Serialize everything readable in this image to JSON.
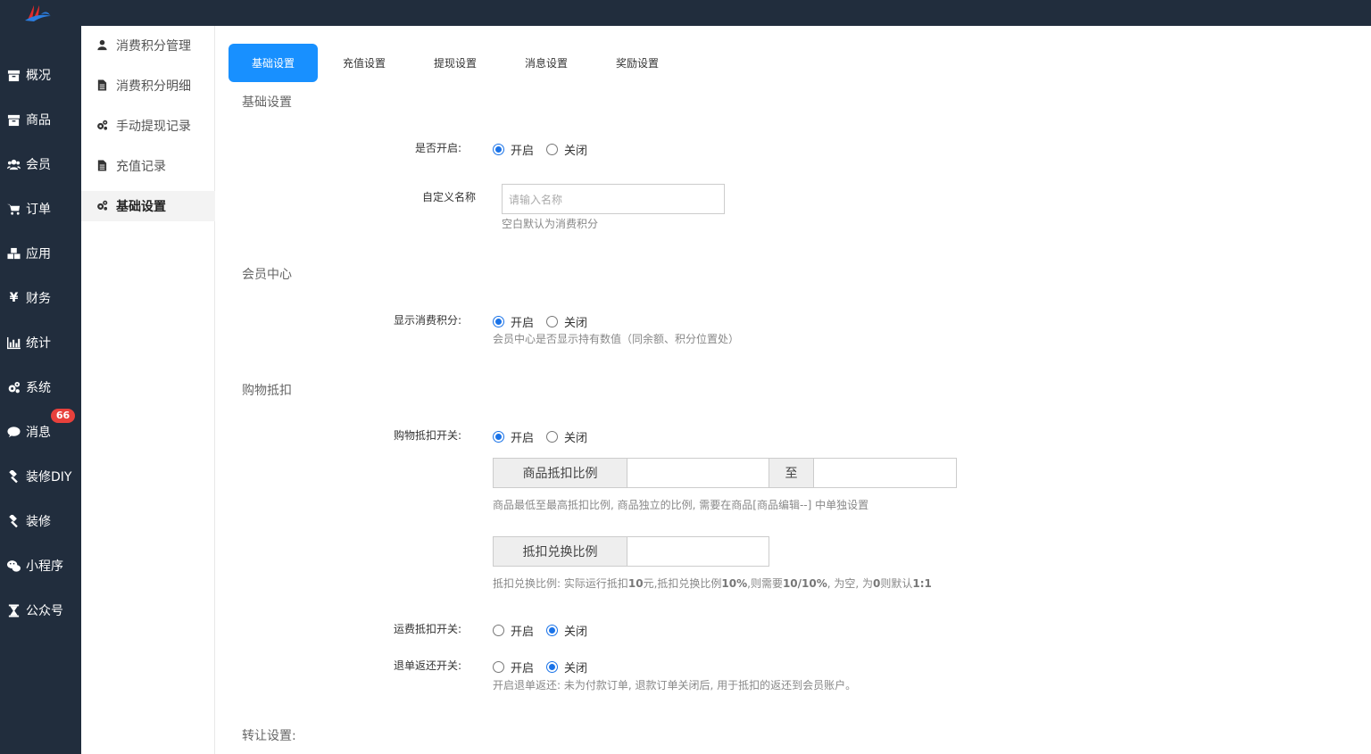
{
  "nav": {
    "items": [
      {
        "label": "概况",
        "icon": "archive-icon"
      },
      {
        "label": "商品",
        "icon": "archive-icon"
      },
      {
        "label": "会员",
        "icon": "users-icon"
      },
      {
        "label": "订单",
        "icon": "cart-icon"
      },
      {
        "label": "应用",
        "icon": "cubes-icon"
      },
      {
        "label": "财务",
        "icon": "yen-icon"
      },
      {
        "label": "统计",
        "icon": "bar-chart-icon"
      },
      {
        "label": "系统",
        "icon": "gears-icon"
      },
      {
        "label": "消息",
        "icon": "comment-icon",
        "badge": "66"
      },
      {
        "label": "装修DIY",
        "icon": "gavel-icon"
      },
      {
        "label": "装修",
        "icon": "gavel-icon"
      },
      {
        "label": "小程序",
        "icon": "wechat-icon"
      },
      {
        "label": "公众号",
        "icon": "hourglass-icon"
      }
    ]
  },
  "subnav": {
    "items": [
      {
        "label": "消费积分管理",
        "icon": "user-icon"
      },
      {
        "label": "消费积分明细",
        "icon": "file-icon"
      },
      {
        "label": "手动提现记录",
        "icon": "gears-icon"
      },
      {
        "label": "充值记录",
        "icon": "file-icon"
      },
      {
        "label": "基础设置",
        "icon": "gears-icon",
        "active": true
      }
    ]
  },
  "tabs": [
    "基础设置",
    "充值设置",
    "提现设置",
    "消息设置",
    "奖励设置"
  ],
  "sections": {
    "basic": "基础设置",
    "member": "会员中心",
    "deduct": "购物抵扣",
    "transfer": "转让设置:"
  },
  "form": {
    "enable_label": "是否开启:",
    "on": "开启",
    "off": "关闭",
    "name_label": "自定义名称",
    "name_placeholder": "请输入名称",
    "name_help": "空白默认为消费积分",
    "show_label": "显示消费积分:",
    "show_help": "会员中心是否显示持有数值（同余额、积分位置处）",
    "deduct_switch_label": "购物抵扣开关:",
    "ratio_addon": "商品抵扣比例",
    "ratio_to": "至",
    "ratio_help": "商品最低至最高抵扣比例, 商品独立的比例, 需要在商品[商品编辑--] 中单独设置",
    "exchange_addon": "抵扣兑换比例",
    "exchange_help_1": "抵扣兑换比例: 实际运行抵扣",
    "exchange_help_2": "10",
    "exchange_help_3": "元,抵扣兑换比例",
    "exchange_help_4": "10%",
    "exchange_help_5": ",则需要",
    "exchange_help_6": "10/10%",
    "exchange_help_7": ", 为空, 为",
    "exchange_help_8": "0",
    "exchange_help_9": "则默认",
    "exchange_help_10": "1:1",
    "freight_label": "运费抵扣开关:",
    "refund_label": "退单返还开关:",
    "refund_help": "开启退单返还: 未为付款订单, 退款订单关闭后, 用于抵扣的返还到会员账户。"
  },
  "colors": {
    "sidebar": "#212d3d",
    "accent": "#1890ff",
    "badge": "#e8413c"
  }
}
